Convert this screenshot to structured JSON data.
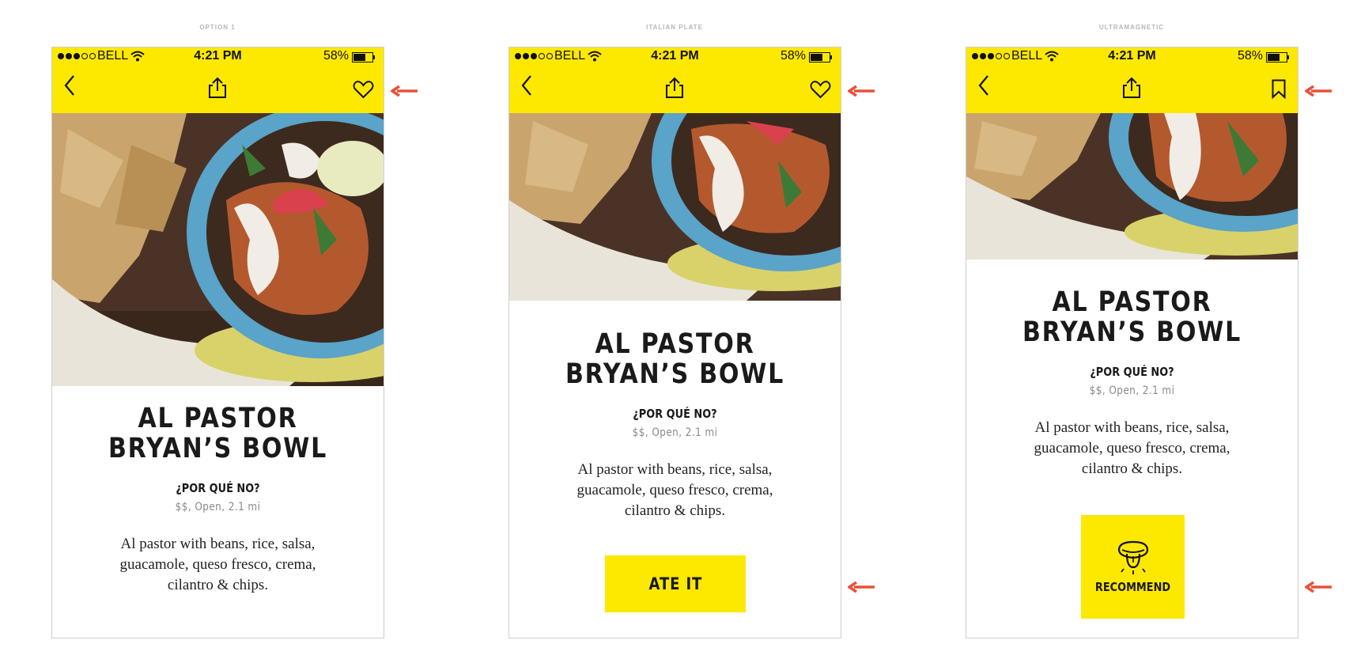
{
  "options": [
    {
      "label": "OPTION 1",
      "status": {
        "carrier": "BELL",
        "time": "4:21 PM",
        "battery": "58%"
      },
      "nav_right_icon": "heart-icon",
      "title_line1": "AL PASTOR",
      "title_line2": "BRYAN’S BOWL",
      "restaurant": "¿POR QUÉ NO?",
      "meta": "$$, Open, 2.1 mi",
      "description": "Al pastor with beans, rice, salsa, guacamole, queso fresco, crema, cilantro & chips.",
      "action": null
    },
    {
      "label": "ITALIAN PLATE",
      "status": {
        "carrier": "BELL",
        "time": "4:21 PM",
        "battery": "58%"
      },
      "nav_right_icon": "heart-icon",
      "title_line1": "AL PASTOR",
      "title_line2": "BRYAN’S BOWL",
      "restaurant": "¿POR QUÉ NO?",
      "meta": "$$, Open, 2.1 mi",
      "description": "Al pastor with beans, rice, salsa, guacamole, queso fresco, crema, cilantro & chips.",
      "action": {
        "label": "ATE IT"
      }
    },
    {
      "label": "ULTRAMAGNETIC",
      "status": {
        "carrier": "BELL",
        "time": "4:21 PM",
        "battery": "58%"
      },
      "nav_right_icon": "bookmark-icon",
      "title_line1": "AL PASTOR",
      "title_line2": "BRYAN’S BOWL",
      "restaurant": "¿POR QUÉ NO?",
      "meta": "$$, Open, 2.1 mi",
      "description": "Al pastor with beans, rice, salsa, guacamole, queso fresco, crema, cilantro & chips.",
      "action": {
        "label": "RECOMMEND",
        "icon": "tongue-icon"
      }
    }
  ],
  "colors": {
    "accent": "#fde800",
    "arrow": "#e8503a",
    "text": "#1a1a1a",
    "meta": "#8a8a8a"
  }
}
